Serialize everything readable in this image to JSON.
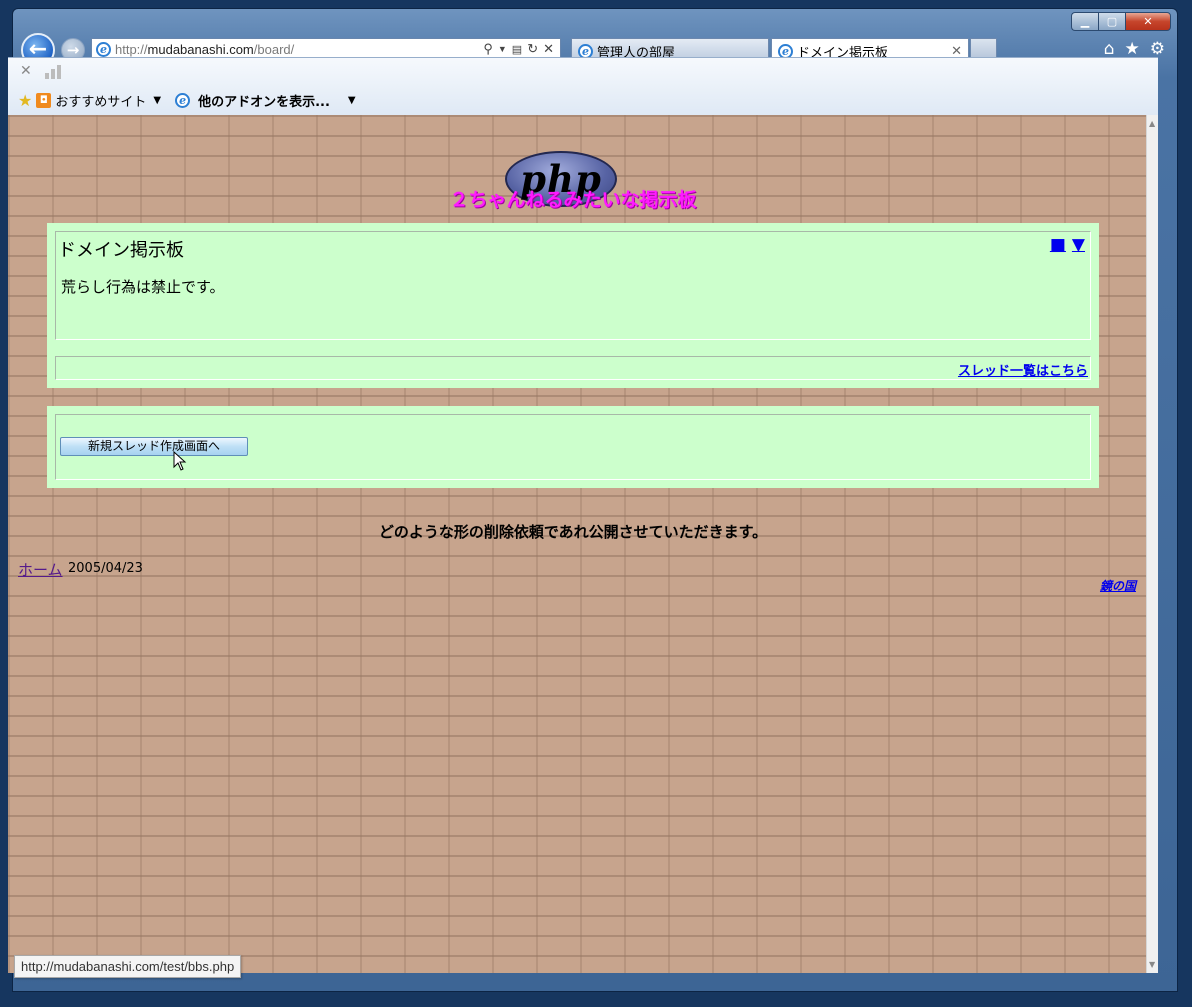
{
  "browser": {
    "address_prefix": "http://",
    "address_host": "mudabanashi.com",
    "address_path": "/board/",
    "tabs": [
      {
        "title": "管理人の部屋"
      },
      {
        "title": "ドメイン掲示板",
        "active": true
      }
    ],
    "favorites": {
      "suggested_sites": "おすすめサイト",
      "more_addons": "他のアドオンを表示..."
    },
    "status_url": "http://mudabanashi.com/test/bbs.php"
  },
  "page": {
    "logo_text": "php",
    "site_title": "２ちゃんねるみたいな掲示板",
    "board_name": "ドメイン掲示板",
    "nav_square": "■",
    "nav_down": "▼",
    "rule_text": "荒らし行為は禁止です。",
    "thread_list_link": "スレッド一覧はこちら",
    "create_button": "新規スレッド作成画面へ",
    "notice": "どのような形の削除依頼であれ公開させていただきます。",
    "home_link": "ホーム",
    "date": "2005/04/23",
    "kagami_link": "鏡の国"
  },
  "colors": {
    "panel_bg": "#ccffcc",
    "title_color": "#ff1aff",
    "link_color": "#0000ee",
    "page_bg": "#c7a48d"
  }
}
